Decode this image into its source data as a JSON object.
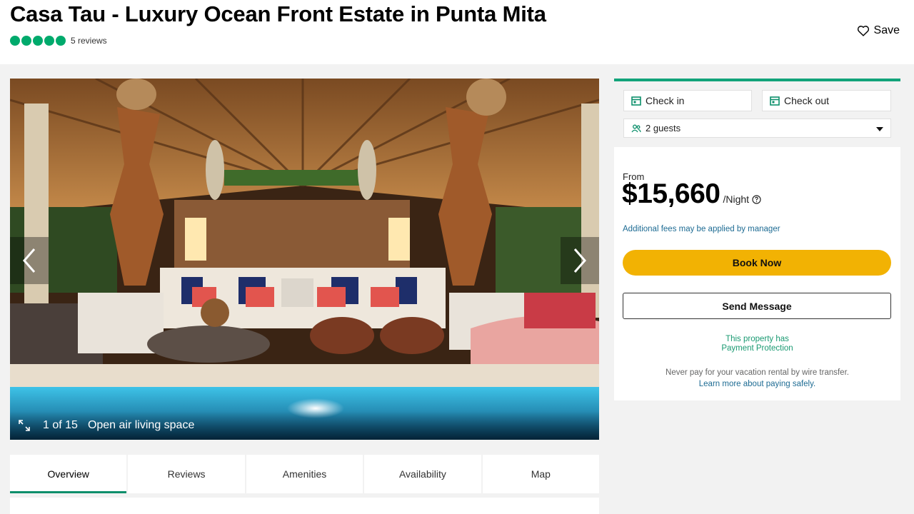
{
  "header": {
    "title": "Casa Tau - Luxury Ocean Front Estate in Punta Mita",
    "rating_bubbles": 5,
    "reviews_label": "5 reviews",
    "save_label": "Save"
  },
  "gallery": {
    "counter": "1 of 15",
    "caption": "Open air living space"
  },
  "tabs": [
    {
      "label": "Overview",
      "active": true
    },
    {
      "label": "Reviews",
      "active": false
    },
    {
      "label": "Amenities",
      "active": false
    },
    {
      "label": "Availability",
      "active": false
    },
    {
      "label": "Map",
      "active": false
    }
  ],
  "booking": {
    "checkin_label": "Check in",
    "checkout_label": "Check out",
    "guests_label": "2 guests",
    "from_label": "From",
    "price": "$15,660",
    "per_night": "/Night",
    "fees_note": "Additional fees may be applied by manager",
    "book_label": "Book Now",
    "message_label": "Send Message",
    "protection_line1": "This property has",
    "protection_line2": "Payment Protection",
    "wire_warning": "Never pay for your vacation rental by wire transfer.",
    "learn_more": "Learn more about paying safely."
  },
  "colors": {
    "rating_green": "#00aa6c",
    "book_yellow": "#f2b203",
    "accent_green": "#12a37a",
    "link_blue": "#1d6b93"
  }
}
